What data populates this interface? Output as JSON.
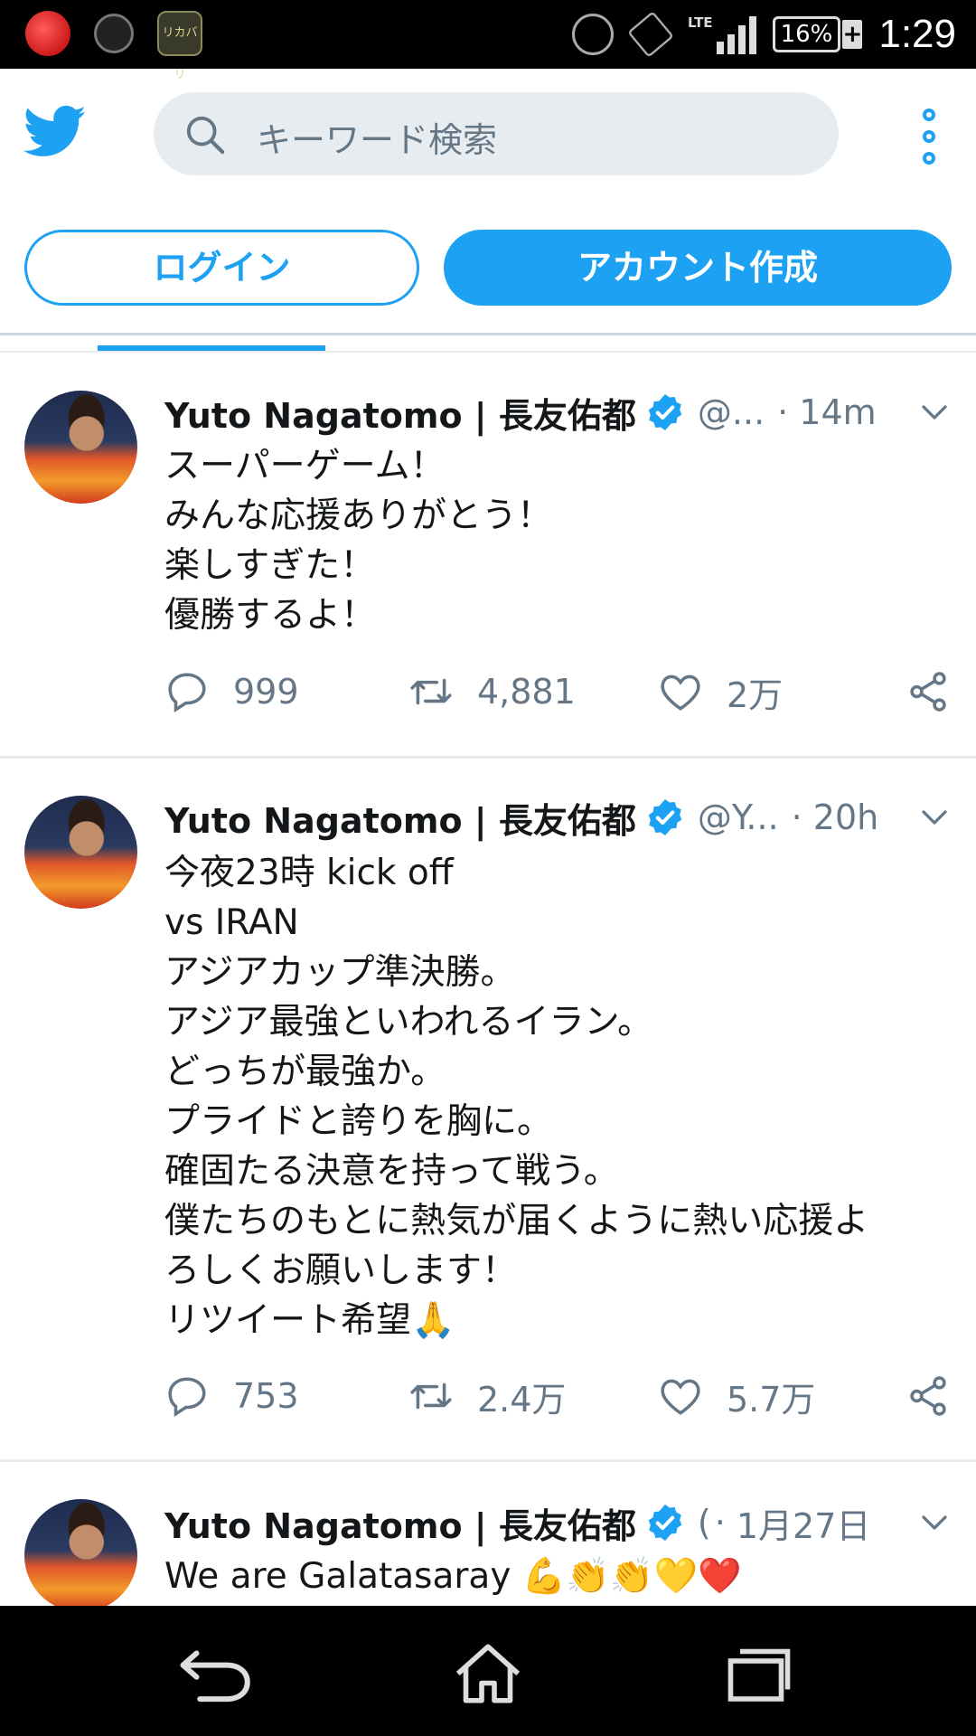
{
  "status_bar": {
    "left_icons": [
      "trend-micro-icon",
      "speed-gauge-icon",
      "app-lab-icon"
    ],
    "lab_label": "リカバリ",
    "network": "LTE",
    "battery": "16%",
    "time": "1:29"
  },
  "header": {
    "logo": "twitter-bird-icon",
    "search_placeholder": "キーワード検索",
    "menu_icon": "more-vertical-icon"
  },
  "auth": {
    "login_label": "ログイン",
    "signup_label": "アカウント作成"
  },
  "colors": {
    "accent": "#1da1f2",
    "muted": "#657786",
    "text": "#14171a",
    "divider": "#e6ecf0"
  },
  "tweets": [
    {
      "name": "Yuto Nagatomo | 長友佑都",
      "handle": "@...",
      "dot": "·",
      "time": "14m",
      "lines": [
        "スーパーゲーム！",
        "みんな応援ありがとう！",
        "楽しすぎた！",
        "優勝するよ！"
      ],
      "replies": "999",
      "retweets": "4,881",
      "likes": "2万"
    },
    {
      "name": "Yuto Nagatomo | 長友佑都",
      "handle": "@Y...",
      "dot": "·",
      "time": "20h",
      "lines": [
        "今夜23時 kick off",
        "vs IRAN",
        "アジアカップ準決勝。",
        "アジア最強といわれるイラン。",
        "どっちが最強か。",
        "プライドと誇りを胸に。",
        "確固たる決意を持って戦う。",
        "僕たちのもとに熱気が届くように熱い応援よ",
        "ろしくお願いします！",
        "リツイート希望🙏"
      ],
      "replies": "753",
      "retweets": "2.4万",
      "likes": "5.7万"
    },
    {
      "name": "Yuto Nagatomo | 長友佑都",
      "handle": "(",
      "dot": "·",
      "time": "1月27日",
      "lines": [
        "We are Galatasaray 💪👏👏💛❤️"
      ]
    }
  ],
  "nav": {
    "back": "back-icon",
    "home": "home-icon",
    "recents": "recents-icon"
  }
}
